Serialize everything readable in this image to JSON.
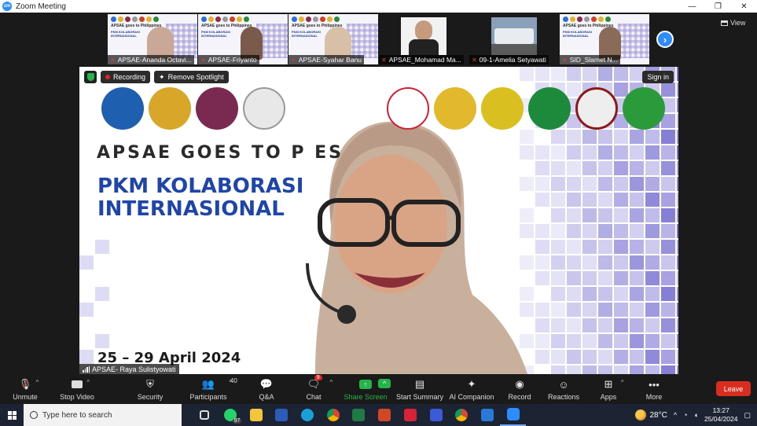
{
  "window": {
    "title": "Zoom Meeting",
    "controls": [
      "—",
      "❐",
      "✕"
    ]
  },
  "participants_strip": {
    "tiles": [
      {
        "name": "APSAE-Ananda Octavi...",
        "muted": true,
        "type": "slide"
      },
      {
        "name": "APSAE-Friyanto",
        "muted": true,
        "type": "slide"
      },
      {
        "name": "APSAE-Syahar Banu",
        "muted": true,
        "type": "slide"
      },
      {
        "name": "APSAE_Mohamad Ma...",
        "muted": true,
        "type": "person"
      },
      {
        "name": "09-1-Amelia Setyawati",
        "muted": true,
        "type": "scene"
      },
      {
        "name": "SID_Slamet N...",
        "muted": true,
        "type": "slide"
      }
    ],
    "slide_mini_title": "APSAE goes to Philippines",
    "slide_mini_sub": "PKM KOLABORASI INTERNASIONAL",
    "next_icon": "›",
    "view_label": "View"
  },
  "stage": {
    "recording_label": "Recording",
    "spotlight_label": "Remove Spotlight",
    "signin_label": "Sign in",
    "slide_headline": "APSAE GOES TO P    ES",
    "slide_title": "PKM KOLABORASI",
    "slide_title2": "INTERNASIONAL",
    "slide_date": "25 – 29 April 2024",
    "active_speaker": "APSAE- Raya Sulistyowati",
    "colors": {
      "accent": "#1f45a8",
      "tile": "#5a50c8"
    }
  },
  "toolbar": {
    "unmute": "Unmute",
    "stop_video": "Stop Video",
    "security": "Security",
    "participants": "Participants",
    "participants_count": "40",
    "qa": "Q&A",
    "chat": "Chat",
    "chat_badge": "9",
    "share_screen": "Share Screen",
    "start_summary": "Start Summary",
    "ai_companion": "AI Companion",
    "record": "Record",
    "reactions": "Reactions",
    "apps": "Apps",
    "more": "More",
    "leave": "Leave"
  },
  "taskbar": {
    "search_placeholder": "Type here to search",
    "whatsapp_badge": "97",
    "temperature": "28°C",
    "time": "13:27",
    "date": "25/04/2024"
  }
}
